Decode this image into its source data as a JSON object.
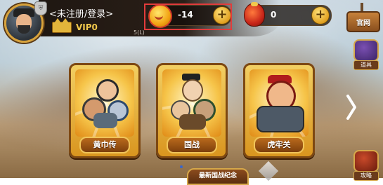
{
  "player": {
    "name": "<未注册/登录>",
    "vip_label": "VIP0",
    "sub_text": "5(L)"
  },
  "currencies": {
    "gold": {
      "value": "-14",
      "icon": "gold-coin-icon",
      "plus_label": "+"
    },
    "ingot": {
      "value": "0",
      "icon": "red-pouch-icon",
      "plus_label": "+"
    }
  },
  "top_right": {
    "official_label": "官网"
  },
  "side_buttons": [
    {
      "label": "道具",
      "icon": "treasure-box-icon"
    },
    {
      "label": "攻略",
      "icon": "scroll-book-icon"
    }
  ],
  "stage_cards": [
    {
      "title": "黄巾传",
      "icon": "warriors-group-icon"
    },
    {
      "title": "国战",
      "icon": "officials-group-icon"
    },
    {
      "title": "虎牢关",
      "icon": "armored-general-icon"
    }
  ],
  "bottom_banner": {
    "label": "最新国战纪念"
  },
  "colors": {
    "highlight": "#e23b3b",
    "gold": "#e3b53b",
    "card_border": "#7d4812"
  }
}
